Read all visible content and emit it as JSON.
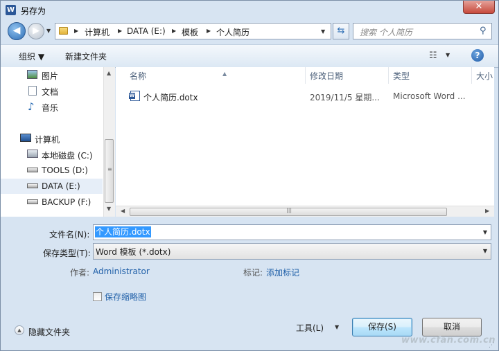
{
  "window": {
    "title": "另存为",
    "close_symbol": "✕",
    "app_icon_letter": "W"
  },
  "address": {
    "back_symbol": "◀",
    "forward_symbol": "▶",
    "breadcrumbs": [
      "计算机",
      "DATA (E:)",
      "模板",
      "个人简历"
    ],
    "search_placeholder": "搜索 个人简历"
  },
  "toolbar": {
    "organize": "组织 ▼",
    "new_folder": "新建文件夹",
    "help_symbol": "?"
  },
  "nav": {
    "items": [
      {
        "label": "图片",
        "icon": "pictures-icon"
      },
      {
        "label": "文档",
        "icon": "documents-icon"
      },
      {
        "label": "音乐",
        "icon": "music-icon"
      },
      {
        "label": "计算机",
        "icon": "computer-icon"
      },
      {
        "label": "本地磁盘 (C:)",
        "icon": "system-drive-icon"
      },
      {
        "label": "TOOLS (D:)",
        "icon": "drive-icon"
      },
      {
        "label": "DATA (E:)",
        "icon": "drive-icon",
        "selected": true
      },
      {
        "label": "BACKUP (F:)",
        "icon": "drive-icon"
      }
    ]
  },
  "list": {
    "columns": [
      "名称",
      "修改日期",
      "类型",
      "大小"
    ],
    "files": [
      {
        "name": "个人简历.dotx",
        "modified": "2019/11/5 星期...",
        "type": "Microsoft Word ...",
        "icon": "word-document-icon"
      }
    ]
  },
  "form": {
    "filename_label": "文件名(N):",
    "filename_value": "个人简历.dotx",
    "filetype_label": "保存类型(T):",
    "filetype_value": "Word 模板 (*.dotx)",
    "author_label": "作者:",
    "author_value": "Administrator",
    "tags_label": "标记:",
    "tags_value": "添加标记",
    "thumbnail_label": "保存缩略图",
    "thumbnail_checked": false
  },
  "footer": {
    "hide_folders": "隐藏文件夹",
    "tools": "工具(L)",
    "save": "保存(S)",
    "cancel": "取消"
  },
  "watermark": "www.cfan.com.cn",
  "colors": {
    "selection": "#3399ff",
    "link": "#1f5fa8",
    "chrome": "#d7e4f2"
  }
}
